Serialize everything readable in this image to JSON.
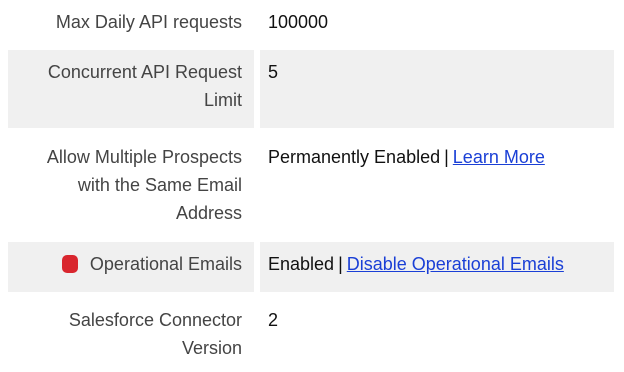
{
  "rows": [
    {
      "label": "Max Daily API requests",
      "value": "100000"
    },
    {
      "label_line1": "Concurrent API Request",
      "label_line2": "Limit",
      "value": "5"
    },
    {
      "label_line1": "Allow Multiple Prospects",
      "label_line2": "with the Same Email",
      "label_line3": "Address",
      "value": "Permanently Enabled",
      "separator": "|",
      "link": "Learn More"
    },
    {
      "label": "Operational Emails",
      "value": "Enabled",
      "separator": "|",
      "link": "Disable Operational Emails",
      "status_color": "#d9262e"
    },
    {
      "label_line1": "Salesforce Connector",
      "label_line2": "Version",
      "value": "2"
    }
  ]
}
